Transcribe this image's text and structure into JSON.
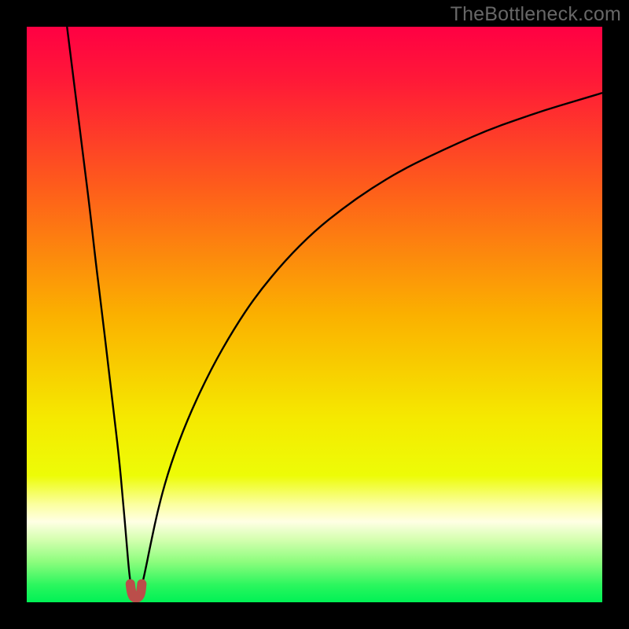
{
  "watermark": "TheBottleneck.com",
  "chart_data": {
    "type": "line",
    "title": "",
    "xlabel": "",
    "ylabel": "",
    "xlim": [
      0,
      100
    ],
    "ylim": [
      0,
      100
    ],
    "grid": false,
    "legend": false,
    "curve_min_x": 19,
    "background_gradient": {
      "stops": [
        {
          "offset": 0.0,
          "color": "#ff0043"
        },
        {
          "offset": 0.09,
          "color": "#ff1838"
        },
        {
          "offset": 0.28,
          "color": "#fe5d1b"
        },
        {
          "offset": 0.5,
          "color": "#fbb000"
        },
        {
          "offset": 0.68,
          "color": "#f5e900"
        },
        {
          "offset": 0.78,
          "color": "#edfc07"
        },
        {
          "offset": 0.83,
          "color": "#fbffa0"
        },
        {
          "offset": 0.86,
          "color": "#ffffe4"
        },
        {
          "offset": 0.89,
          "color": "#d6ffb1"
        },
        {
          "offset": 0.93,
          "color": "#8cfd7d"
        },
        {
          "offset": 0.97,
          "color": "#2bf65e"
        },
        {
          "offset": 1.0,
          "color": "#00f155"
        }
      ]
    },
    "series": [
      {
        "name": "left-branch",
        "color": "#000000",
        "width": 2.4,
        "points": [
          {
            "x": 7.0,
            "y": 100.0
          },
          {
            "x": 8.0,
            "y": 92.0
          },
          {
            "x": 9.0,
            "y": 84.0
          },
          {
            "x": 10.0,
            "y": 76.0
          },
          {
            "x": 11.0,
            "y": 68.0
          },
          {
            "x": 12.0,
            "y": 59.0
          },
          {
            "x": 13.0,
            "y": 51.0
          },
          {
            "x": 14.0,
            "y": 42.5
          },
          {
            "x": 15.0,
            "y": 34.0
          },
          {
            "x": 16.0,
            "y": 25.5
          },
          {
            "x": 16.7,
            "y": 18.0
          },
          {
            "x": 17.3,
            "y": 11.0
          },
          {
            "x": 17.8,
            "y": 5.0
          },
          {
            "x": 18.3,
            "y": 1.5
          }
        ]
      },
      {
        "name": "right-branch",
        "color": "#000000",
        "width": 2.4,
        "points": [
          {
            "x": 19.7,
            "y": 1.5
          },
          {
            "x": 20.5,
            "y": 5.0
          },
          {
            "x": 21.5,
            "y": 10.0
          },
          {
            "x": 23.0,
            "y": 17.0
          },
          {
            "x": 25.0,
            "y": 24.0
          },
          {
            "x": 28.0,
            "y": 32.0
          },
          {
            "x": 32.0,
            "y": 40.5
          },
          {
            "x": 36.0,
            "y": 47.5
          },
          {
            "x": 40.0,
            "y": 53.5
          },
          {
            "x": 45.0,
            "y": 59.5
          },
          {
            "x": 50.0,
            "y": 64.5
          },
          {
            "x": 55.0,
            "y": 68.5
          },
          {
            "x": 60.0,
            "y": 72.0
          },
          {
            "x": 65.0,
            "y": 75.0
          },
          {
            "x": 70.0,
            "y": 77.5
          },
          {
            "x": 75.0,
            "y": 79.8
          },
          {
            "x": 80.0,
            "y": 82.0
          },
          {
            "x": 85.0,
            "y": 83.8
          },
          {
            "x": 90.0,
            "y": 85.5
          },
          {
            "x": 95.0,
            "y": 87.0
          },
          {
            "x": 100.0,
            "y": 88.5
          }
        ]
      },
      {
        "name": "bottom-marker",
        "color": "#bb4e4a",
        "width": 12,
        "linecap": "round",
        "points": [
          {
            "x": 18.0,
            "y": 3.2
          },
          {
            "x": 18.2,
            "y": 1.2
          },
          {
            "x": 19.0,
            "y": 0.6
          },
          {
            "x": 19.8,
            "y": 1.2
          },
          {
            "x": 20.0,
            "y": 3.2
          }
        ]
      }
    ]
  }
}
